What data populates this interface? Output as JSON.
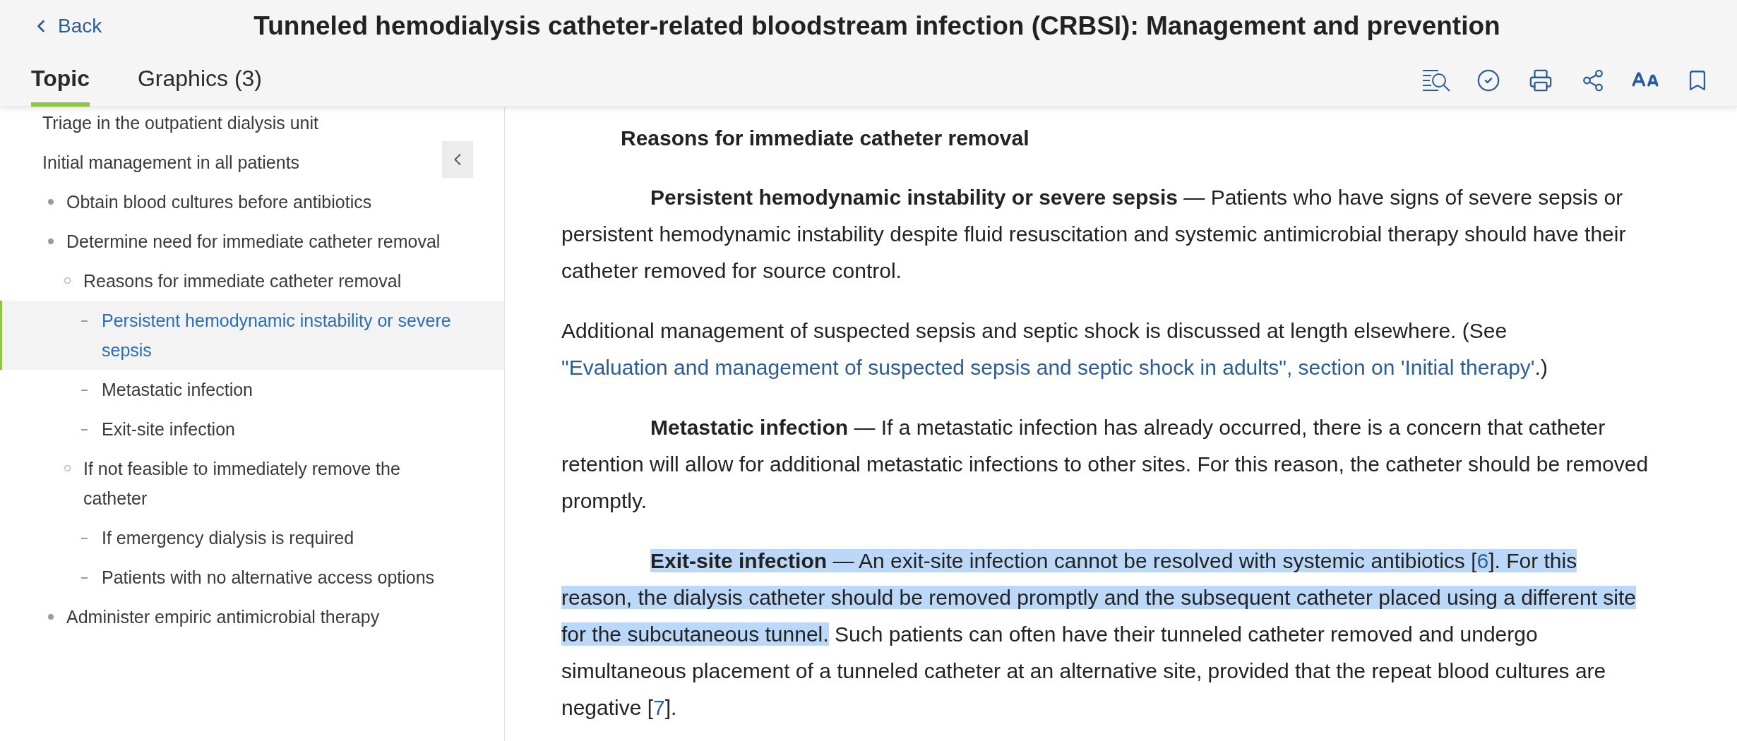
{
  "header": {
    "back": "Back",
    "title": "Tunneled hemodialysis catheter-related bloodstream infection (CRBSI): Management and prevention",
    "tabs": [
      {
        "label": "Topic",
        "selected": true
      },
      {
        "label": "Graphics (3)",
        "selected": false
      }
    ]
  },
  "sidebar": {
    "items": [
      {
        "label": "Triage in the outpatient dialysis unit",
        "selected": false
      },
      {
        "label": "Initial management in all patients",
        "selected": false,
        "children": [
          {
            "label": "Obtain blood cultures before antibiotics",
            "selected": false
          },
          {
            "label": "Determine need for immediate catheter removal",
            "selected": false,
            "children": [
              {
                "label": "Reasons for immediate catheter removal",
                "selected": false,
                "children": [
                  {
                    "label": "Persistent hemodynamic instability or severe sepsis",
                    "selected": true
                  },
                  {
                    "label": "Metastatic infection",
                    "selected": false
                  },
                  {
                    "label": "Exit-site infection",
                    "selected": false
                  }
                ]
              },
              {
                "label": "If not feasible to immediately remove the catheter",
                "selected": false,
                "children": [
                  {
                    "label": "If emergency dialysis is required",
                    "selected": false
                  },
                  {
                    "label": "Patients with no alternative access options",
                    "selected": false
                  }
                ]
              }
            ]
          },
          {
            "label": "Administer empiric antimicrobial therapy",
            "selected": false
          }
        ]
      }
    ]
  },
  "content": {
    "blocks": [
      {
        "kind": "heading",
        "text": "Reasons for immediate catheter removal"
      },
      {
        "kind": "paragraph",
        "indent": true,
        "segments": [
          {
            "kind": "bold",
            "text": "Persistent hemodynamic instability or severe sepsis",
            "selected": false
          },
          {
            "kind": "text",
            "text": " — Patients who have signs of severe sepsis or persistent hemodynamic instability despite fluid resuscitation and systemic antimicrobial therapy should have their catheter removed for source control.",
            "selected": false
          }
        ]
      },
      {
        "kind": "paragraph",
        "indent": false,
        "segments": [
          {
            "kind": "text",
            "text": "Additional management of suspected sepsis and septic shock is discussed at length elsewhere. (See ",
            "selected": false
          },
          {
            "kind": "link",
            "text": "\"Evaluation and management of suspected sepsis and septic shock in adults\", section on 'Initial therapy'",
            "selected": false
          },
          {
            "kind": "text",
            "text": ".)",
            "selected": false
          }
        ]
      },
      {
        "kind": "paragraph",
        "indent": true,
        "segments": [
          {
            "kind": "bold",
            "text": "Metastatic infection",
            "selected": false
          },
          {
            "kind": "text",
            "text": " — If a metastatic infection has already occurred, there is a concern that catheter retention will allow for additional metastatic infections to other sites. For this reason, the catheter should be removed promptly.",
            "selected": false
          }
        ]
      },
      {
        "kind": "paragraph",
        "indent": true,
        "segments": [
          {
            "kind": "bold",
            "text": "Exit-site infection",
            "selected": true
          },
          {
            "kind": "text",
            "text": " — An exit-site infection cannot be resolved with systemic antibiotics [",
            "selected": true
          },
          {
            "kind": "ref",
            "text": "6",
            "selected": true
          },
          {
            "kind": "text",
            "text": "]. For this reason, the dialysis catheter should be removed promptly and the subsequent catheter placed using a different site for the subcutaneous tunnel.",
            "selected": true
          },
          {
            "kind": "text",
            "text": " Such patients can often have their tunneled catheter removed and undergo simultaneous placement of a tunneled catheter at an alternative site, provided that the repeat blood cultures are negative [",
            "selected": false
          },
          {
            "kind": "ref",
            "text": "7",
            "selected": false
          },
          {
            "kind": "text",
            "text": "].",
            "selected": false
          }
        ]
      }
    ]
  }
}
